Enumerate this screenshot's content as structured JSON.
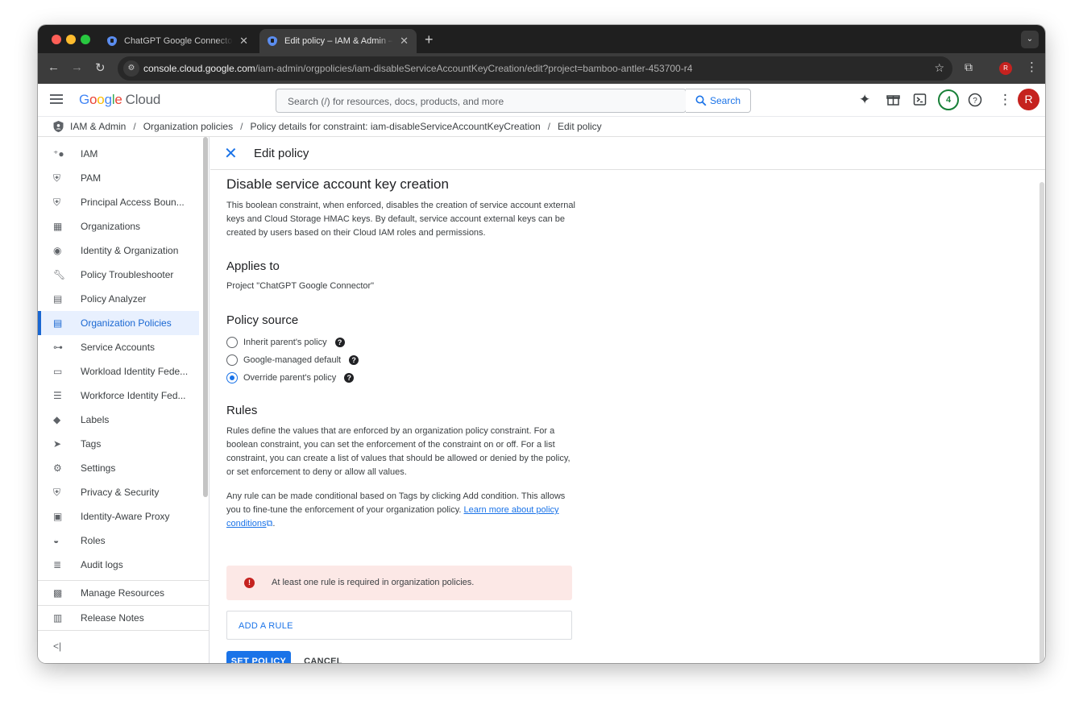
{
  "browser": {
    "tabs": [
      {
        "title": "ChatGPT Google Connector – ",
        "active": false
      },
      {
        "title": "Edit policy – IAM & Admin – G",
        "active": true
      }
    ],
    "url_host": "console.cloud.google.com",
    "url_path": "/iam-admin/orgpolicies/iam-disableServiceAccountKeyCreation/edit?project=bamboo-antler-453700-r4",
    "profile_initial": "R"
  },
  "header": {
    "logo_letters": [
      "G",
      "o",
      "o",
      "g",
      "l",
      "e"
    ],
    "logo_suffix": "Cloud",
    "search_placeholder": "Search (/) for resources, docs, products, and more",
    "search_button": "Search",
    "notifications_count": "4",
    "avatar_initial": "R"
  },
  "breadcrumb": {
    "items": [
      "IAM & Admin",
      "Organization policies",
      "Policy details for constraint:  iam-disableServiceAccountKeyCreation",
      "Edit policy"
    ],
    "separator": "/"
  },
  "sidebar": {
    "items": [
      {
        "label": "IAM",
        "icon": "person-add-icon"
      },
      {
        "label": "PAM",
        "icon": "shield-icon"
      },
      {
        "label": "Principal Access Boun...",
        "icon": "shield-lock-icon"
      },
      {
        "label": "Organizations",
        "icon": "building-icon"
      },
      {
        "label": "Identity & Organization",
        "icon": "account-circle-icon"
      },
      {
        "label": "Policy Troubleshooter",
        "icon": "wrench-icon"
      },
      {
        "label": "Policy Analyzer",
        "icon": "document-search-icon"
      },
      {
        "label": "Organization Policies",
        "icon": "list-doc-icon",
        "active": true
      },
      {
        "label": "Service Accounts",
        "icon": "service-account-icon"
      },
      {
        "label": "Workload Identity Fede...",
        "icon": "id-card-icon"
      },
      {
        "label": "Workforce Identity Fed...",
        "icon": "list-icon"
      },
      {
        "label": "Labels",
        "icon": "tag-icon"
      },
      {
        "label": "Tags",
        "icon": "label-arrow-icon"
      },
      {
        "label": "Settings",
        "icon": "gear-icon"
      },
      {
        "label": "Privacy & Security",
        "icon": "privacy-shield-icon"
      },
      {
        "label": "Identity-Aware Proxy",
        "icon": "proxy-icon"
      },
      {
        "label": "Roles",
        "icon": "hat-icon"
      },
      {
        "label": "Audit logs",
        "icon": "lines-icon"
      }
    ],
    "bottom_items": [
      {
        "label": "Manage Resources",
        "icon": "folder-gear-icon"
      },
      {
        "label": "Release Notes",
        "icon": "notes-icon"
      }
    ],
    "collapse_label": "<|"
  },
  "main": {
    "panel_title": "Edit policy",
    "constraint_title": "Disable service account key creation",
    "description": "This boolean constraint, when enforced, disables the creation of service account external keys and Cloud Storage HMAC keys. By default, service account external keys can be created by users based on their Cloud IAM roles and permissions.",
    "applies_to_heading": "Applies to",
    "applies_to_value": "Project \"ChatGPT Google Connector\"",
    "policy_source_heading": "Policy source",
    "policy_source_options": [
      {
        "label": "Inherit parent's policy",
        "selected": false
      },
      {
        "label": "Google-managed default",
        "selected": false
      },
      {
        "label": "Override parent's policy",
        "selected": true
      }
    ],
    "rules_heading": "Rules",
    "rules_description": "Rules define the values that are enforced by an organization policy constraint. For a boolean constraint, you can set the enforcement of the constraint on or off. For a list constraint, you can create a list of values that should be allowed or denied by the policy, or set enforcement to deny or allow all values.",
    "rules_conditional_text": "Any rule can be made conditional based on Tags by clicking Add condition. This allows you to fine-tune the enforcement of your organization policy.",
    "rules_link_text": "Learn more about policy conditions",
    "alert_text": "At least one rule is required in organization policies.",
    "add_rule_label": "ADD A RULE",
    "set_policy_label": "SET POLICY",
    "cancel_label": "CANCEL"
  },
  "colors": {
    "accent": "#1a73e8",
    "active_nav_bg": "#e8f0fe",
    "alert_bg": "#fce8e6",
    "error": "#c5221f"
  }
}
